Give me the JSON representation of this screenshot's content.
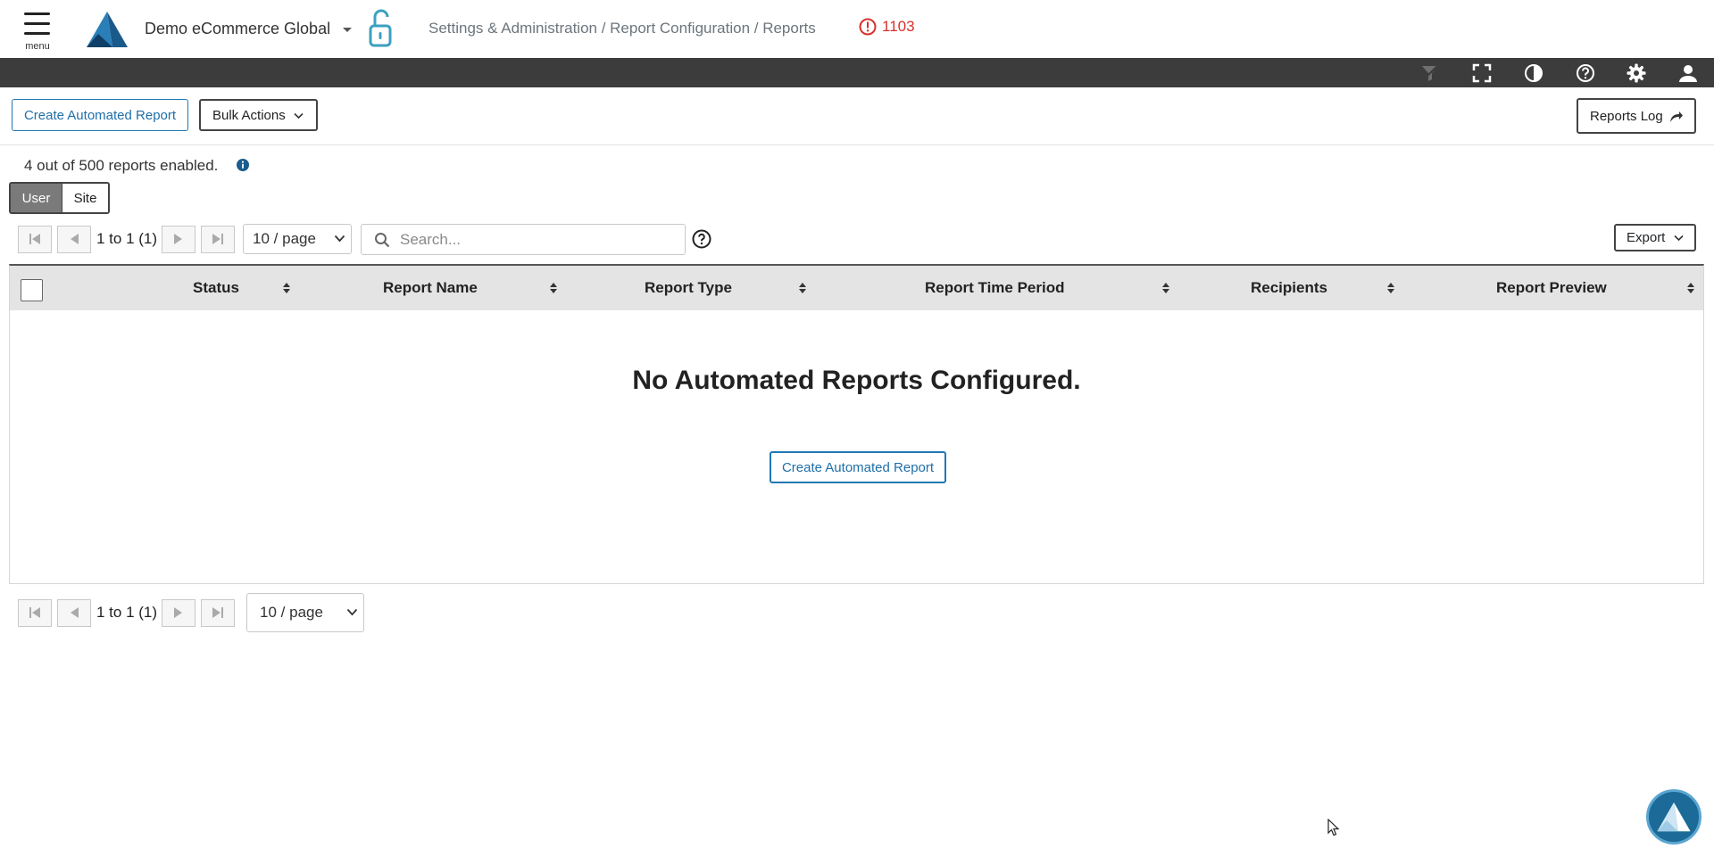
{
  "header": {
    "menu_label": "menu",
    "org_name": "Demo eCommerce Global",
    "breadcrumb": "Settings & Administration / Report Configuration / Reports",
    "alert_count": "1103"
  },
  "toolbar": {
    "icons": [
      "filter-icon",
      "fullscreen-icon",
      "contrast-icon",
      "help-icon",
      "gear-icon",
      "user-icon"
    ]
  },
  "actions": {
    "create_label": "Create Automated Report",
    "bulk_label": "Bulk Actions",
    "reports_log_label": "Reports Log"
  },
  "summary": {
    "enabled_text": "4 out of 500 reports enabled."
  },
  "scope_toggle": {
    "options": [
      "User",
      "Site"
    ],
    "selected": "User"
  },
  "pagination_top": {
    "range": "1 to 1 (1)",
    "page_size": "10 / page"
  },
  "pagination_bottom": {
    "range": "1 to 1 (1)",
    "page_size": "10 / page"
  },
  "search": {
    "placeholder": "Search..."
  },
  "export_label": "Export",
  "table": {
    "columns": [
      "Status",
      "Report Name",
      "Report Type",
      "Report Time Period",
      "Recipients",
      "Report Preview"
    ],
    "rows": [],
    "empty_title": "No Automated Reports Configured.",
    "empty_button_label": "Create Automated Report"
  },
  "colors": {
    "accent": "#1f78b4",
    "alert": "#d9302c",
    "toolbar_bg": "#3c3c3c",
    "header_row_bg": "#e4e4e4"
  }
}
